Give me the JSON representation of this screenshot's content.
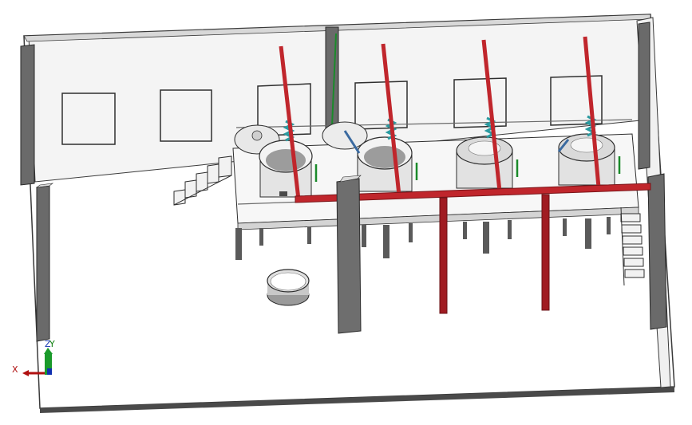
{
  "viewport": {
    "background": "#ffffff",
    "colors": {
      "floor": "#ffffff",
      "wall_face": "#f2f2f2",
      "wall_edge": "#5a5a5a",
      "pillar_dark": "#6e6e6e",
      "pipe_red": "#c0262c",
      "pipe_red_dark": "#7a1418",
      "tank_body": "#e6e6e6",
      "tank_shadow": "#9a9a9a",
      "cable_green": "#1a8a2a",
      "coil_teal": "#2a9aa0"
    }
  },
  "triad": {
    "x_label": "X",
    "y_label": "Y",
    "z_label": "Z",
    "x_color": "#b01010",
    "y_color": "#108010",
    "z_color": "#1030b0"
  }
}
